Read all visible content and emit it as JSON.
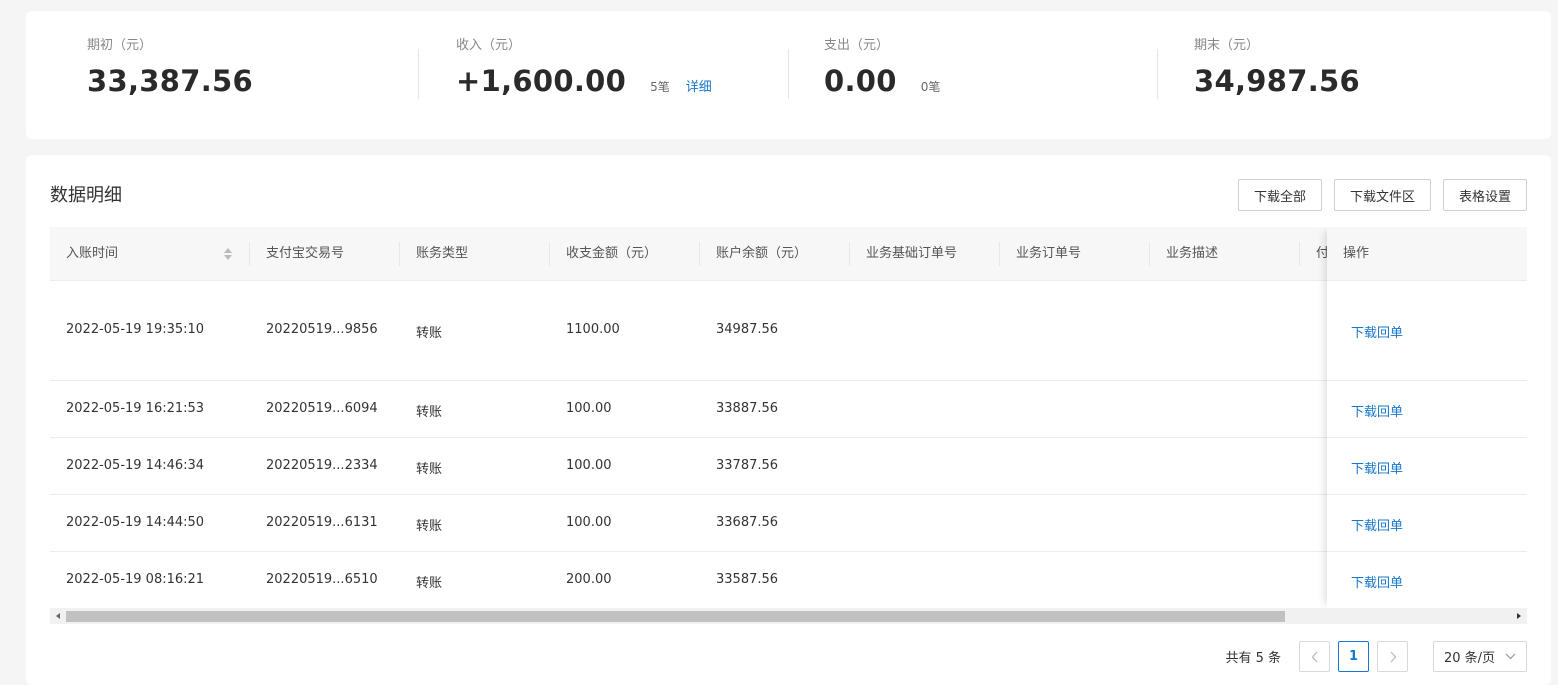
{
  "summary": {
    "opening": {
      "label": "期初（元）",
      "value": "33,387.56"
    },
    "income": {
      "label": "收入（元）",
      "value": "+1,600.00",
      "count": "5笔",
      "link": "详细"
    },
    "expense": {
      "label": "支出（元）",
      "value": "0.00",
      "count": "0笔"
    },
    "closing": {
      "label": "期末（元）",
      "value": "34,987.56"
    }
  },
  "detail": {
    "title": "数据明细",
    "toolbar": {
      "download_all": "下载全部",
      "download_area": "下载文件区",
      "table_settings": "表格设置"
    },
    "columns": [
      "入账时间",
      "支付宝交易号",
      "账务类型",
      "收支金额（元）",
      "账户余额（元）",
      "业务基础订单号",
      "业务订单号",
      "业务描述",
      "付"
    ],
    "action_column": "操作",
    "rows": [
      {
        "time": "2022-05-19 19:35:10",
        "trade_no": "20220519...9856",
        "type": "转账",
        "amount": "1100.00",
        "balance": "34987.56",
        "action": "下载回单"
      },
      {
        "time": "2022-05-19 16:21:53",
        "trade_no": "20220519...6094",
        "type": "转账",
        "amount": "100.00",
        "balance": "33887.56",
        "action": "下载回单"
      },
      {
        "time": "2022-05-19 14:46:34",
        "trade_no": "20220519...2334",
        "type": "转账",
        "amount": "100.00",
        "balance": "33787.56",
        "action": "下载回单"
      },
      {
        "time": "2022-05-19 14:44:50",
        "trade_no": "20220519...6131",
        "type": "转账",
        "amount": "100.00",
        "balance": "33687.56",
        "action": "下载回单"
      },
      {
        "time": "2022-05-19 08:16:21",
        "trade_no": "20220519...6510",
        "type": "转账",
        "amount": "200.00",
        "balance": "33587.56",
        "action": "下载回单"
      }
    ]
  },
  "pagination": {
    "total_text": "共有 5 条",
    "current_page": "1",
    "page_size": "20 条/页"
  },
  "colors": {
    "link": "#1677cc",
    "background": "#f5f5f5",
    "header_bg": "#f7f7f7"
  },
  "icons": {
    "sort": "sort-icon",
    "prev": "chevron-left-icon",
    "next": "chevron-right-icon",
    "dropdown": "chevron-down-icon"
  }
}
